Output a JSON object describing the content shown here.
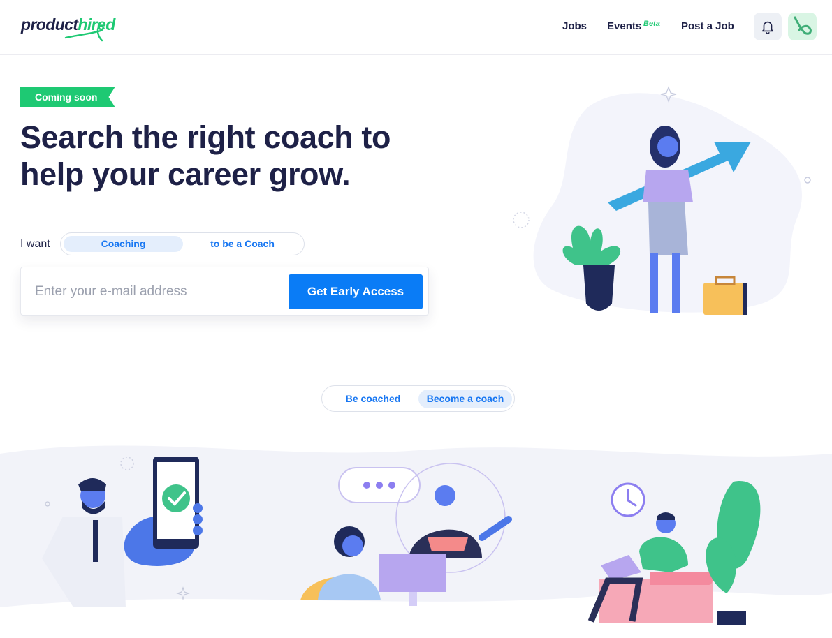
{
  "header": {
    "logo": {
      "part1": "product",
      "part2": "hired"
    },
    "nav": [
      {
        "label": "Jobs"
      },
      {
        "label": "Events",
        "badge": "Beta"
      },
      {
        "label": "Post a Job"
      }
    ],
    "icons": {
      "notifications": "bell-icon",
      "profile": "avatar-icon"
    }
  },
  "hero": {
    "badge": "Coming soon",
    "title_line1": "Search the right coach to",
    "title_line2": "help your career grow.",
    "i_want_label": "I want",
    "toggle": {
      "options": [
        "Coaching",
        "to be a Coach"
      ],
      "selected": "Coaching"
    },
    "email": {
      "placeholder": "Enter your e-mail address",
      "value": ""
    },
    "cta": "Get Early Access"
  },
  "segment": {
    "options": [
      "Be coached",
      "Become a coach"
    ],
    "selected": "Become a coach"
  },
  "colors": {
    "brand_green": "#1ec973",
    "brand_navy": "#1e2147",
    "primary_blue": "#0a7cf6",
    "chip_bg": "#e4eefc"
  }
}
